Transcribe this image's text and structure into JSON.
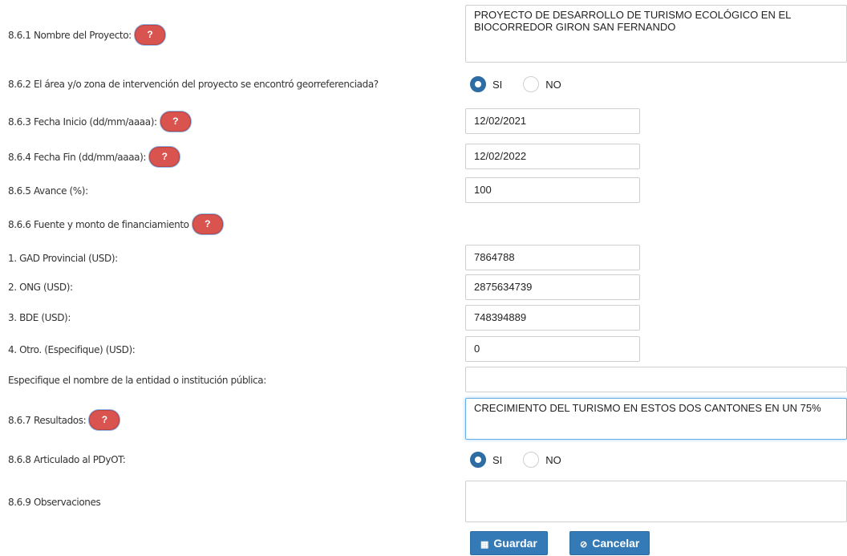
{
  "help_glyph": "?",
  "fields": {
    "nombre": {
      "label": "8.6.1 Nombre del Proyecto:",
      "value": "PROYECTO DE DESARROLLO DE TURISMO ECOLÓGICO EN EL BIOCORREDOR GIRON SAN FERNANDO"
    },
    "georref": {
      "label": "8.6.2 El área y/o zona de intervención del proyecto se encontró georreferenciada?",
      "opt_si": "SI",
      "opt_no": "NO",
      "selected": "SI"
    },
    "fecha_inicio": {
      "label": "8.6.3 Fecha Inicio (dd/mm/aaaa):",
      "value": "12/02/2021"
    },
    "fecha_fin": {
      "label": "8.6.4 Fecha Fin (dd/mm/aaaa):",
      "value": "12/02/2022"
    },
    "avance": {
      "label": "8.6.5 Avance (%):",
      "value": "100"
    },
    "fuente": {
      "label": "8.6.6 Fuente y monto de financiamiento"
    },
    "gad": {
      "label": "1. GAD Provincial (USD):",
      "value": "7864788"
    },
    "ong": {
      "label": "2. ONG (USD):",
      "value": "2875634739"
    },
    "bde": {
      "label": "3. BDE (USD):",
      "value": "748394889"
    },
    "otro": {
      "label": "4. Otro. (Especifique) (USD):",
      "value": "0"
    },
    "entidad": {
      "label": "Especifique el nombre de la entidad o institución pública:",
      "value": ""
    },
    "resultados": {
      "label": "8.6.7 Resultados:",
      "value": "CRECIMIENTO DEL TURISMO EN ESTOS DOS CANTONES EN UN 75%"
    },
    "articulado": {
      "label": "8.6.8 Articulado al PDyOT:",
      "opt_si": "SI",
      "opt_no": "NO",
      "selected": "SI"
    },
    "observaciones": {
      "label": "8.6.9 Observaciones",
      "value": ""
    }
  },
  "buttons": {
    "guardar": {
      "label": "Guardar",
      "icon": "save-icon"
    },
    "cancelar": {
      "label": "Cancelar",
      "icon": "ban-icon"
    }
  },
  "colors": {
    "help_bg": "#d9534f",
    "primary": "#337ab7"
  }
}
